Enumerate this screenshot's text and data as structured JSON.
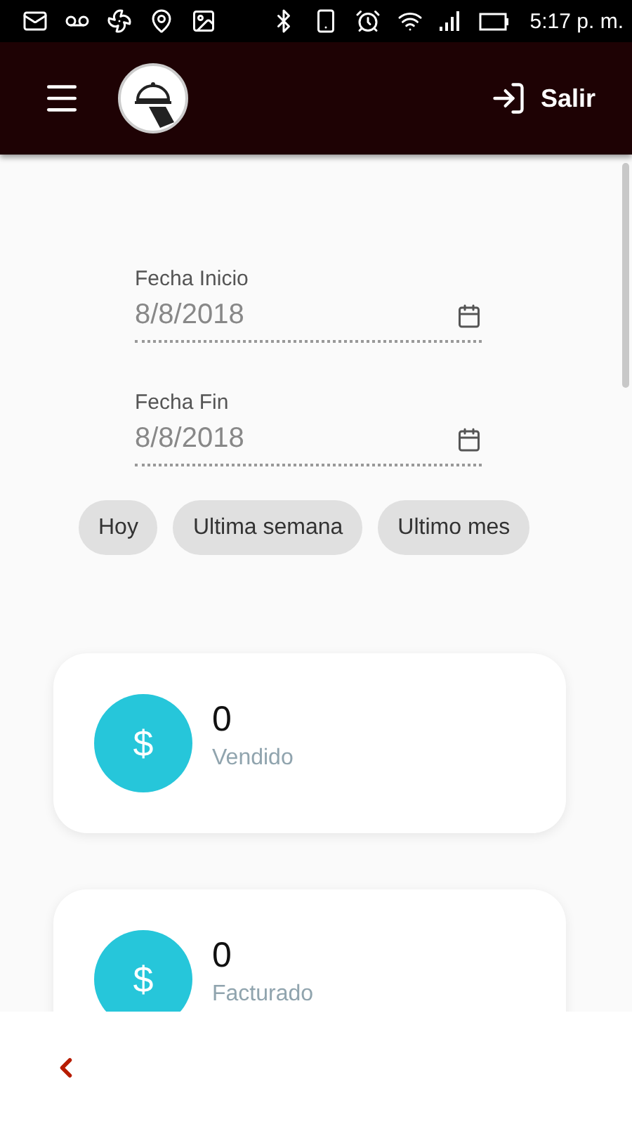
{
  "status_bar": {
    "time": "5:17 p. m."
  },
  "header": {
    "logout": "Salir"
  },
  "date_fields": [
    {
      "label": "Fecha Inicio",
      "value": "8/8/2018"
    },
    {
      "label": "Fecha Fin",
      "value": "8/8/2018"
    }
  ],
  "quick_ranges": [
    {
      "label": "Hoy"
    },
    {
      "label": "Ultima semana"
    },
    {
      "label": "Ultimo mes"
    }
  ],
  "stats": [
    {
      "symbol": "$",
      "value": "0",
      "label": "Vendido"
    },
    {
      "symbol": "$",
      "value": "0",
      "label": "Facturado"
    }
  ]
}
